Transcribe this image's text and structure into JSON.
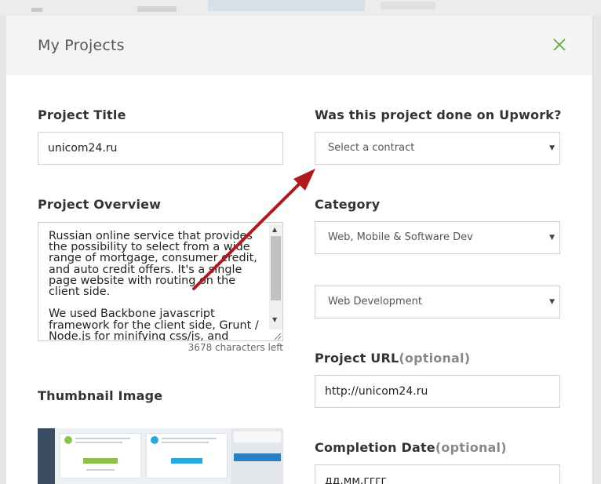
{
  "modal": {
    "title": "My Projects"
  },
  "form": {
    "project_title": {
      "label": "Project Title",
      "value": "unicom24.ru"
    },
    "project_overview": {
      "label": "Project Overview",
      "value": "Russian online service that provides the possibility to select from a wide range of mortgage, consumer credit, and auto credit offers. It's a single page website with routing on the client side.\n\nWe used Backbone javascript framework for the client side, Grunt / Node.js for minifying css/js, and",
      "chars_left": "3678 characters left"
    },
    "thumbnail": {
      "label": "Thumbnail Image"
    },
    "upwork": {
      "label": "Was this project done on Upwork?",
      "selected": "Select a contract"
    },
    "category": {
      "label": "Category",
      "selected": "Web, Mobile & Software Dev",
      "sub_selected": "Web Development"
    },
    "project_url": {
      "label": "Project URL",
      "optional": "(optional)",
      "value": "http://unicom24.ru"
    },
    "completion_date": {
      "label": "Completion Date",
      "optional": "(optional)",
      "placeholder": "дд.мм.гггг"
    }
  },
  "icons": {
    "close": "close-icon",
    "caret": "caret-down-icon",
    "annotation": "red-arrow-annotation"
  },
  "colors": {
    "accent_green": "#5ea83b",
    "annotation_red": "#b11a1a",
    "header_bg": "#f4f4f4"
  }
}
